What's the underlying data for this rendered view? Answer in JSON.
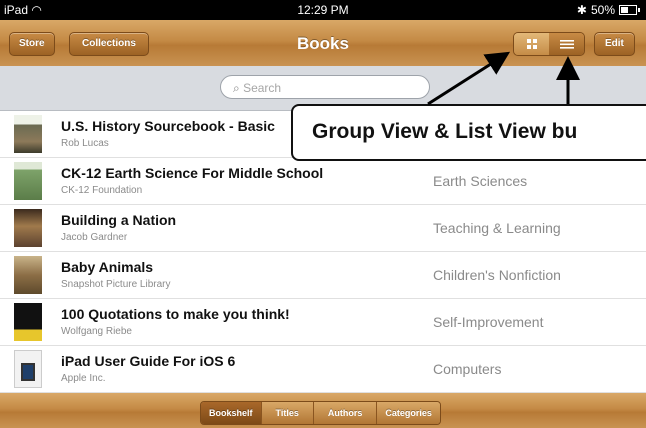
{
  "status_bar": {
    "device": "iPad",
    "time": "12:29 PM",
    "battery": "50%"
  },
  "toolbar": {
    "store_label": "Store",
    "collections_label": "Collections",
    "title": "Books",
    "edit_label": "Edit",
    "view_mode": "list",
    "accent": "#c48a45"
  },
  "search": {
    "placeholder": "Search"
  },
  "books": [
    {
      "title": "U.S. History Sourcebook - Basic",
      "author": "Rob Lucas",
      "category": ""
    },
    {
      "title": "CK-12 Earth Science For Middle School",
      "author": "CK-12 Foundation",
      "category": "Earth Sciences"
    },
    {
      "title": "Building a Nation",
      "author": "Jacob Gardner",
      "category": "Teaching & Learning"
    },
    {
      "title": "Baby Animals",
      "author": "Snapshot Picture Library",
      "category": "Children's Nonfiction"
    },
    {
      "title": "100 Quotations to make you think!",
      "author": "Wolfgang Riebe",
      "category": "Self-Improvement"
    },
    {
      "title": "iPad User Guide For iOS 6",
      "author": "Apple Inc.",
      "category": "Computers"
    }
  ],
  "bottom_tabs": {
    "bookshelf": "Bookshelf",
    "titles": "Titles",
    "authors": "Authors",
    "categories": "Categories",
    "active": "bookshelf"
  },
  "callout": {
    "text": "Group View & List View bu"
  }
}
